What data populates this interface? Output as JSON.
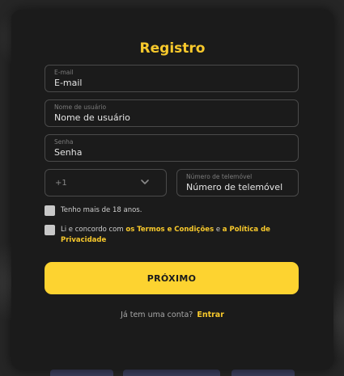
{
  "form": {
    "title": "Registro",
    "email": {
      "label": "E-mail",
      "placeholder": "E-mail"
    },
    "username": {
      "label": "Nome de usuário",
      "placeholder": "Nome de usuário"
    },
    "password": {
      "label": "Senha",
      "placeholder": "Senha"
    },
    "country_code": {
      "value": "+1"
    },
    "phone": {
      "label": "Número de telemóvel",
      "placeholder": "Número de telemóvel"
    },
    "age_check": {
      "label": "Tenho mais de 18 anos."
    },
    "terms_check": {
      "prefix": "Li e concordo com ",
      "terms_link": "os Termos e Condições",
      "connector": " e ",
      "privacy_link": "a Política de Privacidade"
    },
    "submit_label": "PRÓXIMO",
    "footer": {
      "prompt": "Já tem uma conta?",
      "login_link": "Entrar"
    }
  },
  "colors": {
    "accent": "#f8c92c",
    "button": "#fdd330",
    "modal_bg": "#1b1b1b"
  }
}
